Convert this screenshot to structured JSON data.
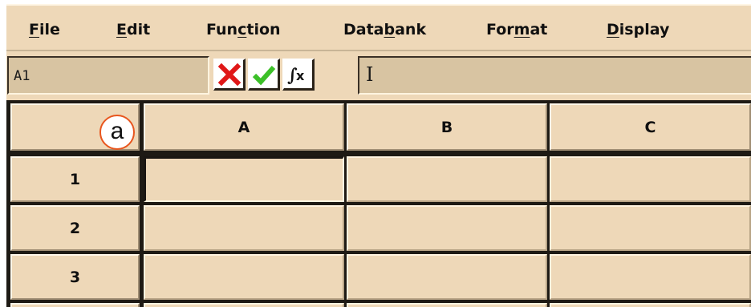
{
  "menubar": {
    "items": [
      {
        "pre": "",
        "mnemonic": "F",
        "post": "ile"
      },
      {
        "pre": "",
        "mnemonic": "E",
        "post": "dit"
      },
      {
        "pre": "Fun",
        "mnemonic": "c",
        "post": "tion"
      },
      {
        "pre": "Data",
        "mnemonic": "b",
        "post": "ank"
      },
      {
        "pre": "For",
        "mnemonic": "m",
        "post": "at"
      },
      {
        "pre": "",
        "mnemonic": "D",
        "post": "isplay"
      }
    ]
  },
  "formula_bar": {
    "name_box": "A1",
    "buttons": [
      {
        "icon": "cancel-x-icon",
        "color": "#e01818"
      },
      {
        "icon": "accept-check-icon",
        "color": "#3cc028"
      },
      {
        "icon": "function-fx-icon",
        "color": "#101010"
      }
    ],
    "formula_value": "",
    "cursor": "I"
  },
  "grid": {
    "columns": [
      "A",
      "B",
      "C"
    ],
    "rows": [
      "1",
      "2",
      "3"
    ],
    "active_cell": "A1"
  },
  "callout": {
    "label": "a",
    "color": "#e8561e"
  }
}
